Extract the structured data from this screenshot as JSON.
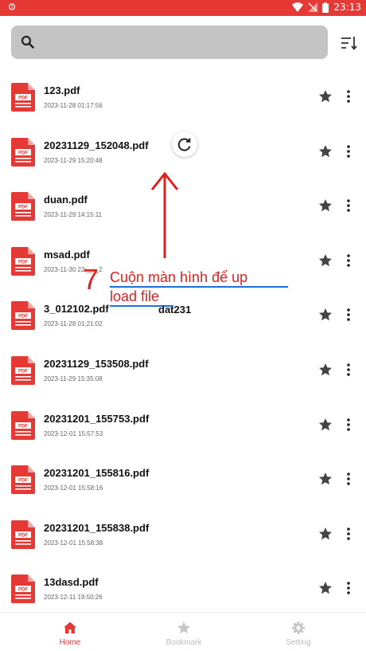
{
  "status_bar": {
    "time": "23:13"
  },
  "search": {
    "placeholder": ""
  },
  "files": [
    {
      "name": "123.pdf",
      "date": "2023-11-28 01:17:56"
    },
    {
      "name": "20231129_152048.pdf",
      "date": "2023-11-29 15:20:48"
    },
    {
      "name": "duan.pdf",
      "date": "2023-11-29 14:15:11"
    },
    {
      "name": "msad.pdf",
      "date": "2023-11-30 22:__:_2"
    },
    {
      "name": "3_012102.pdf",
      "date": "2023-11-28 01:21:02"
    },
    {
      "name": "20231129_153508.pdf",
      "date": "2023-11-29 15:35:08"
    },
    {
      "name": "20231201_155753.pdf",
      "date": "2023-12-01 15:57:53"
    },
    {
      "name": "20231201_155816.pdf",
      "date": "2023-12-01 15:58:16"
    },
    {
      "name": "20231201_155838.pdf",
      "date": "2023-12-01 15:58:38"
    },
    {
      "name": "13dasd.pdf",
      "date": "2023-12-11 19:50:26"
    }
  ],
  "overlay": {
    "number": "7",
    "text_line1": "Cuộn màn hình để up",
    "text_line2": "load file",
    "ghost_text": "dat231"
  },
  "nav": {
    "home": "Home",
    "bookmark": "Bookmark",
    "setting": "Setting"
  },
  "colors": {
    "accent": "#e53935",
    "pdf_red": "#e53935",
    "inactive": "#bdbdbd",
    "annotation": "#e0201c",
    "underline": "#1e6fd9"
  }
}
